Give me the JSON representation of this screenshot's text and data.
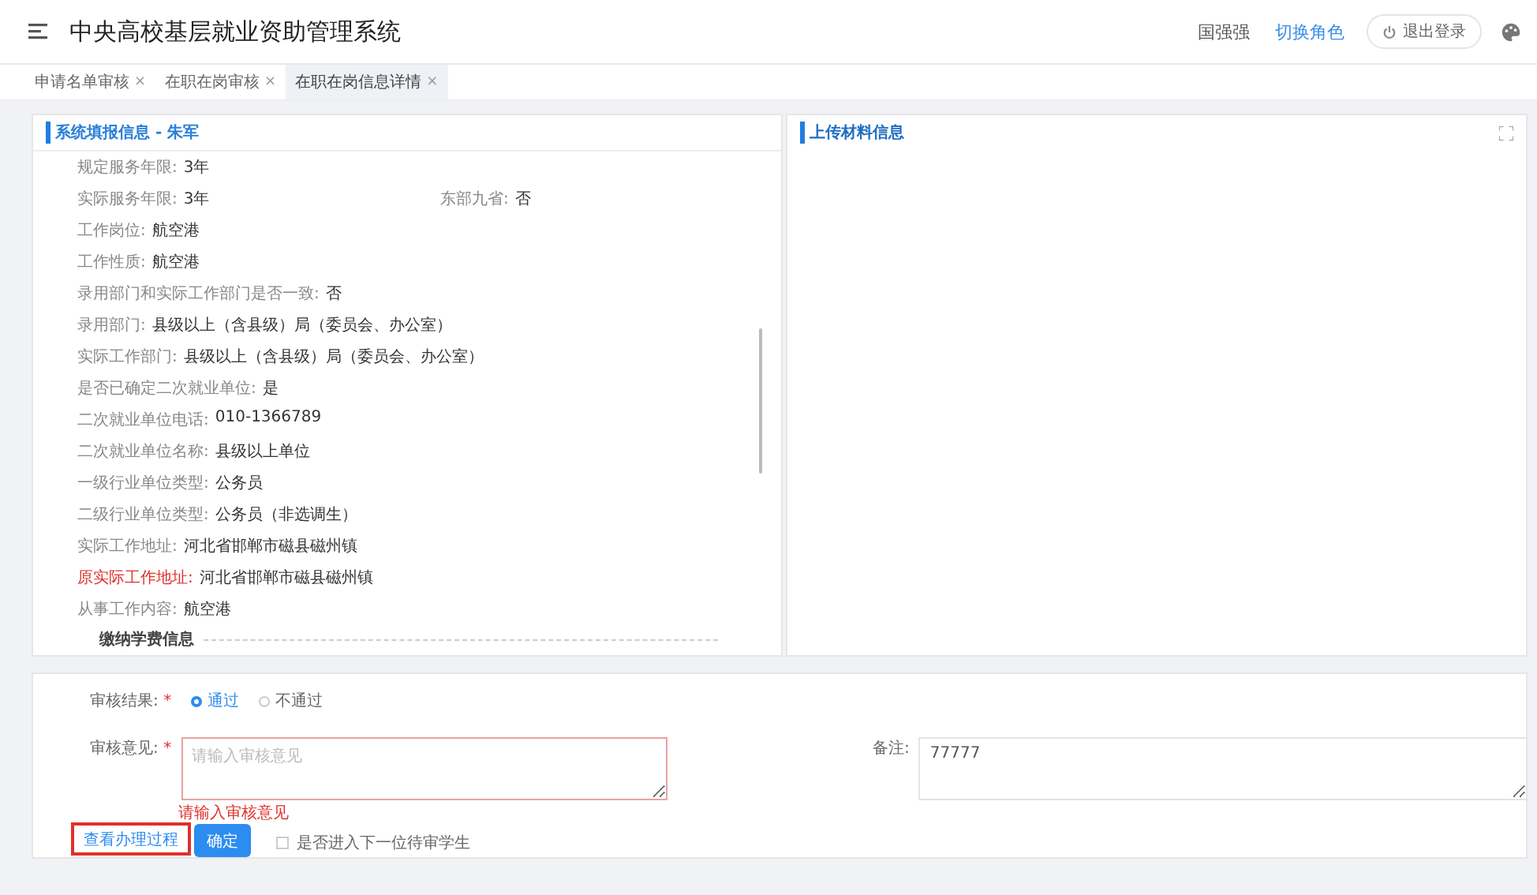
{
  "header": {
    "title": "中央高校基层就业资助管理系统",
    "user": "国强强",
    "switch_role": "切换角色",
    "logout": "退出登录"
  },
  "tabs": [
    {
      "label": "申请名单审核",
      "close": "×",
      "selected": false
    },
    {
      "label": "在职在岗审核",
      "close": "×",
      "selected": false
    },
    {
      "label": "在职在岗信息详情",
      "close": "×",
      "selected": true
    }
  ],
  "info_panel": {
    "title": "系统填报信息 - 朱军",
    "rows": [
      {
        "fields": [
          {
            "label": "规定服务年限:",
            "value": "3年",
            "highlight": false
          }
        ]
      },
      {
        "fields": [
          {
            "label": "实际服务年限:",
            "value": "3年",
            "highlight": false
          },
          {
            "label": "东部九省:",
            "value": "否",
            "highlight": false
          }
        ]
      },
      {
        "fields": [
          {
            "label": "工作岗位:",
            "value": "航空港",
            "highlight": false
          }
        ]
      },
      {
        "fields": [
          {
            "label": "工作性质:",
            "value": "航空港",
            "highlight": false
          }
        ]
      },
      {
        "fields": [
          {
            "label": "录用部门和实际工作部门是否一致:",
            "value": "否",
            "highlight": false
          }
        ]
      },
      {
        "fields": [
          {
            "label": "录用部门:",
            "value": "县级以上（含县级）局（委员会、办公室）",
            "highlight": false
          }
        ]
      },
      {
        "fields": [
          {
            "label": "实际工作部门:",
            "value": "县级以上（含县级）局（委员会、办公室）",
            "highlight": false
          }
        ]
      },
      {
        "fields": [
          {
            "label": "是否已确定二次就业单位:",
            "value": "是",
            "highlight": false
          }
        ]
      },
      {
        "fields": [
          {
            "label": "二次就业单位电话:",
            "value": "010-1366789",
            "highlight": false
          }
        ]
      },
      {
        "fields": [
          {
            "label": "二次就业单位名称:",
            "value": "县级以上单位",
            "highlight": false
          }
        ]
      },
      {
        "fields": [
          {
            "label": "一级行业单位类型:",
            "value": "公务员",
            "highlight": false
          }
        ]
      },
      {
        "fields": [
          {
            "label": "二级行业单位类型:",
            "value": "公务员（非选调生）",
            "highlight": false
          }
        ]
      },
      {
        "fields": [
          {
            "label": "实际工作地址:",
            "value": "河北省邯郸市磁县磁州镇",
            "highlight": false
          }
        ]
      },
      {
        "fields": [
          {
            "label": "原实际工作地址:",
            "value": "河北省邯郸市磁县磁州镇",
            "highlight": true
          }
        ]
      },
      {
        "fields": [
          {
            "label": "从事工作内容:",
            "value": "航空港",
            "highlight": false
          }
        ]
      }
    ],
    "section_title": "缴纳学费信息"
  },
  "upload_panel": {
    "title": "上传材料信息"
  },
  "review_form": {
    "result_label": "审核结果:",
    "required_mark": "*",
    "options": [
      {
        "label": "通过",
        "selected": true
      },
      {
        "label": "不通过",
        "selected": false
      }
    ],
    "opinion_label": "审核意见:",
    "opinion_placeholder": "请输入审核意见",
    "opinion_error": "请输入审核意见",
    "remark_label": "备注:",
    "remark_value": "77777",
    "process_link": "查看办理过程",
    "confirm_button": "确定",
    "next_student": {
      "label": "是否进入下一位待审学生",
      "checked": false
    }
  }
}
